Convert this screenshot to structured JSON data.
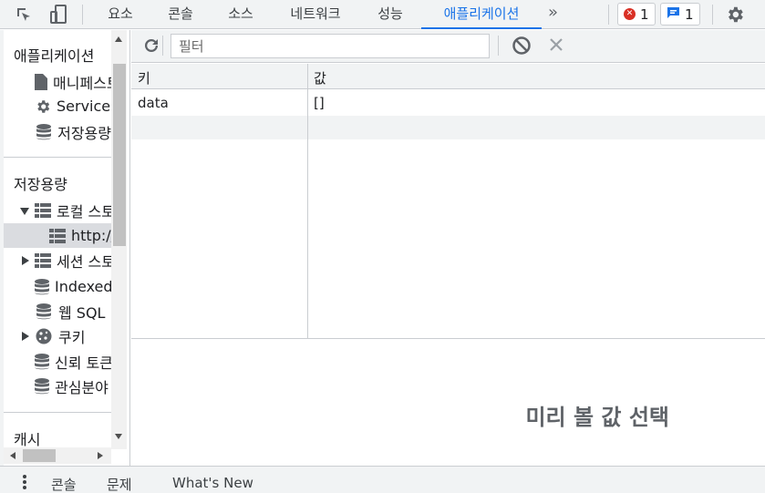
{
  "toolbar": {
    "tabs": [
      "요소",
      "콘솔",
      "소스",
      "네트워크",
      "성능",
      "애플리케이션"
    ],
    "active_tab": "애플리케이션",
    "error_count": "1",
    "message_count": "1",
    "accent_color": "#1a73e8",
    "error_color": "#d93025"
  },
  "sidebar": {
    "app_header": "애플리케이션",
    "app_items": [
      "매니페스트",
      "Service Workers",
      "저장용량"
    ],
    "storage_header": "저장용량",
    "storage_items": [
      "로컬 스토리지",
      "http://",
      "세션 스토리지",
      "IndexedDB",
      "웹 SQL",
      "쿠키",
      "신뢰 토큰",
      "관심분야 그룹"
    ],
    "cache_header": "캐시"
  },
  "filter": {
    "placeholder": "필터"
  },
  "table": {
    "columns": [
      "키",
      "값"
    ],
    "rows": [
      {
        "key": "data",
        "value": "[]"
      }
    ]
  },
  "preview": {
    "text": "미리 볼 값 선택"
  },
  "drawer": {
    "items": [
      "콘솔",
      "문제",
      "What's New"
    ]
  }
}
